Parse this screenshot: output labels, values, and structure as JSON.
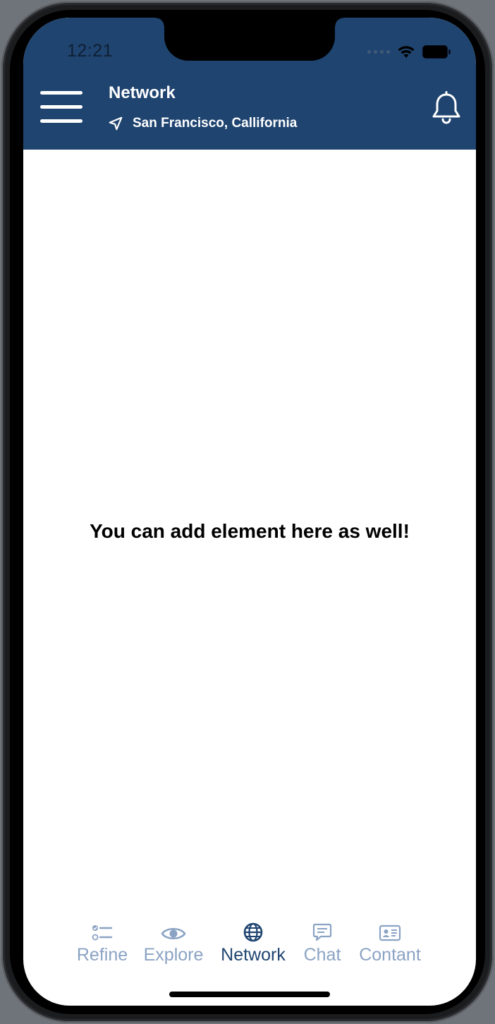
{
  "status_bar": {
    "time": "12:21"
  },
  "header": {
    "title": "Network",
    "location": "San Francisco, Callifornia",
    "background_color": "#1f4470"
  },
  "main": {
    "message": "You can add element here as well!"
  },
  "tabbar": {
    "active_color": "#1f4470",
    "inactive_color": "#8ba3c4",
    "tabs": [
      {
        "label": "Refine",
        "icon": "checklist-icon",
        "active": false
      },
      {
        "label": "Explore",
        "icon": "eye-icon",
        "active": false
      },
      {
        "label": "Network",
        "icon": "globe-icon",
        "active": true
      },
      {
        "label": "Chat",
        "icon": "chat-bubble-icon",
        "active": false
      },
      {
        "label": "Contant",
        "icon": "contact-card-icon",
        "active": false
      }
    ]
  }
}
